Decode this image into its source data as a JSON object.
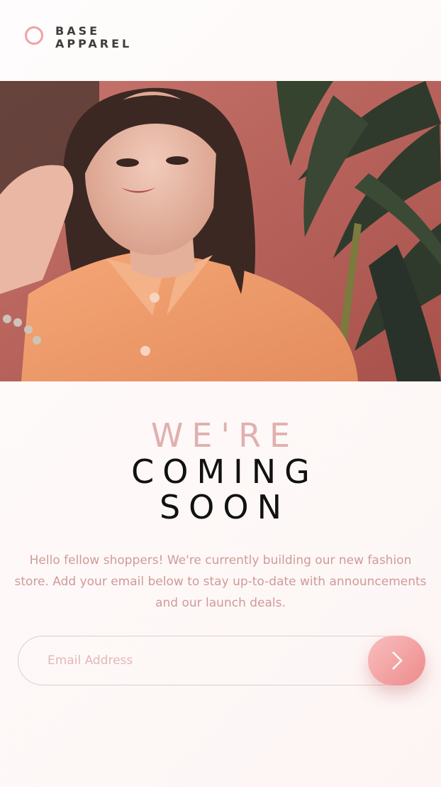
{
  "brand": {
    "line1": "BASE",
    "line2": "APPAREL",
    "accent_color": "#f0a2a5"
  },
  "hero": {
    "image_icon": "hero-photo"
  },
  "headline": {
    "light": "WE'RE",
    "bold_line1": "COMING",
    "bold_line2": "SOON"
  },
  "intro": {
    "text": "Hello fellow shoppers! We're currently building our new fashion store. Add your email below to stay up-to-date with announcements and our launch deals."
  },
  "form": {
    "email_placeholder": "Email Address",
    "submit_icon": "arrow-right-icon",
    "button_color": "#ee8a8b"
  }
}
